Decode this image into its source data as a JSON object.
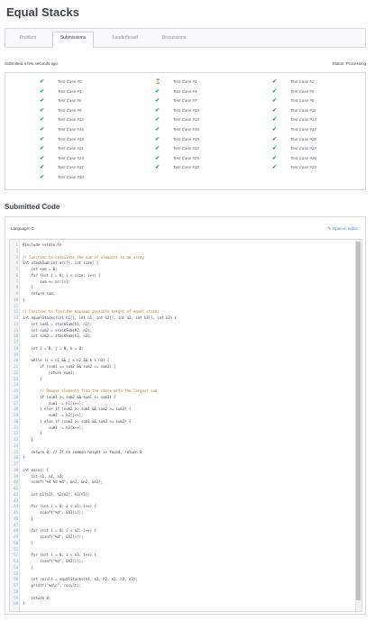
{
  "page": {
    "title": "Equal Stacks"
  },
  "tabs": [
    {
      "label": "Problem",
      "active": false
    },
    {
      "label": "Submissions",
      "active": true
    },
    {
      "label": "Leaderboard",
      "active": false
    },
    {
      "label": "Discussions",
      "active": false
    }
  ],
  "submission": {
    "submitted_text": "Submitted a few seconds ago",
    "status_text": "Status: Processing"
  },
  "test_cases": [
    {
      "label": "Test Case #0",
      "status": "passed"
    },
    {
      "label": "Test Case #1",
      "status": "pending"
    },
    {
      "label": "Test Case #2",
      "status": "passed"
    },
    {
      "label": "Test Case #3",
      "status": "passed"
    },
    {
      "label": "Test Case #4",
      "status": "passed"
    },
    {
      "label": "Test Case #5",
      "status": "passed"
    },
    {
      "label": "Test Case #6",
      "status": "passed"
    },
    {
      "label": "Test Case #7",
      "status": "passed"
    },
    {
      "label": "Test Case #8",
      "status": "passed"
    },
    {
      "label": "Test Case #9",
      "status": "passed"
    },
    {
      "label": "Test Case #10",
      "status": "passed"
    },
    {
      "label": "Test Case #11",
      "status": "passed"
    },
    {
      "label": "Test Case #12",
      "status": "passed"
    },
    {
      "label": "Test Case #13",
      "status": "passed"
    },
    {
      "label": "Test Case #14",
      "status": "passed"
    },
    {
      "label": "Test Case #15",
      "status": "passed"
    },
    {
      "label": "Test Case #16",
      "status": "passed"
    },
    {
      "label": "Test Case #17",
      "status": "passed"
    },
    {
      "label": "Test Case #18",
      "status": "passed"
    },
    {
      "label": "Test Case #19",
      "status": "passed"
    },
    {
      "label": "Test Case #20",
      "status": "passed"
    },
    {
      "label": "Test Case #21",
      "status": "passed"
    },
    {
      "label": "Test Case #22",
      "status": "passed"
    },
    {
      "label": "Test Case #23",
      "status": "passed"
    },
    {
      "label": "Test Case #24",
      "status": "passed"
    },
    {
      "label": "Test Case #25",
      "status": "passed"
    },
    {
      "label": "Test Case #26",
      "status": "passed"
    },
    {
      "label": "Test Case #27",
      "status": "passed"
    },
    {
      "label": "Test Case #28",
      "status": "passed"
    },
    {
      "label": "Test Case #29",
      "status": "passed"
    },
    {
      "label": "Test Case #30",
      "status": "passed"
    }
  ],
  "icons": {
    "passed": "check-icon",
    "pending": "hourglass-icon"
  },
  "colors": {
    "passed": "#1ba94c",
    "link": "#3a8ed6",
    "comment": "#b8791f"
  },
  "code_section": {
    "title": "Submitted Code",
    "language_label": "Language: C",
    "open_editor_label": "Open in editor"
  },
  "code_lines": [
    "#include <stdio.h>",
    "",
    "// Function to calculate the sum of elements in an array",
    "int stackSum(int arr[], int size) {",
    "    int sum = 0;",
    "    for (int i = 0; i < size; i++) {",
    "        sum += arr[i];",
    "    }",
    "    return sum;",
    "}",
    "",
    "// Function to find the maximum possible height of equal stacks",
    "int equalStacks(int h1[], int n1, int h2[], int n2, int h3[], int n3) {",
    "    int sum1 = stackSum(h1, n1);",
    "    int sum2 = stackSum(h2, n2);",
    "    int sum3 = stackSum(h3, n3);",
    "",
    "    int i = 0, j = 0, k = 0;",
    "",
    "    while (i < n1 && j < n2 && k < n3) {",
    "        if (sum1 == sum2 && sum2 == sum3) {",
    "            return sum1;",
    "        }",
    "",
    "        // Remove elements from the stack with the largest sum",
    "        if (sum1 >= sum2 && sum1 >= sum3) {",
    "            sum1 -= h1[i++];",
    "        } else if (sum2 >= sum1 && sum2 >= sum3) {",
    "            sum2 -= h2[j++];",
    "        } else if (sum3 >= sum1 && sum3 >= sum2) {",
    "            sum3 -= h3[k++];",
    "        }",
    "    }",
    "",
    "    return 0; // If no common height is found, return 0",
    "}",
    "",
    "int main() {",
    "    int n1, n2, n3;",
    "    scanf(\"%d %d %d\", &n1, &n2, &n3);",
    "",
    "    int h1[n1], h2[n2], h3[n3];",
    "",
    "    for (int i = 0; i < n1; i++) {",
    "        scanf(\"%d\", &h1[i]);",
    "    }",
    "",
    "    for (int i = 0; i < n2; i++) {",
    "        scanf(\"%d\", &h2[i]);",
    "    }",
    "",
    "    for (int i = 0; i < n3; i++) {",
    "        scanf(\"%d\", &h3[i]);",
    "    }",
    "",
    "    int result = equalStacks(h1, n1, h2, n2, h3, n3);",
    "    printf(\"%d\\n\", result);",
    "",
    "    return 0;",
    "}"
  ]
}
